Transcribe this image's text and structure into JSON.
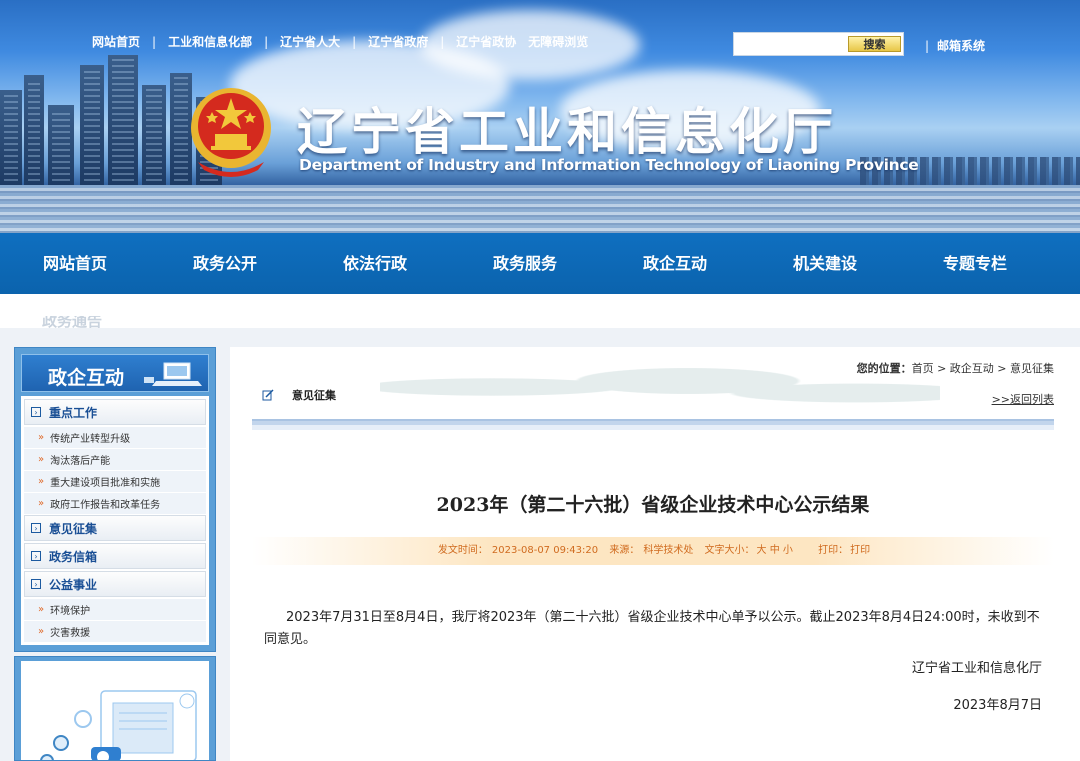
{
  "top_links": [
    "网站首页",
    "工业和信息化部",
    "辽宁省人大",
    "辽宁省政府",
    "辽宁省政协",
    "无障碍浏览"
  ],
  "search": {
    "placeholder": "",
    "button": "搜索"
  },
  "mail_link": "邮箱系统",
  "site": {
    "title": "辽宁省工业和信息化厅",
    "subtitle": "Department of Industry and Information Technology of Liaoning Province"
  },
  "main_nav": [
    "网站首页",
    "政务公开",
    "依法行政",
    "政务服务",
    "政企互动",
    "机关建设",
    "专题专栏"
  ],
  "strip_text": "政务通告",
  "sidebar": {
    "title": "政企互动",
    "groups": [
      {
        "label": "重点工作",
        "items": [
          "传统产业转型升级",
          "淘汰落后产能",
          "重大建设项目批准和实施",
          "政府工作报告和改革任务"
        ]
      },
      {
        "label": "意见征集",
        "items": []
      },
      {
        "label": "政务信箱",
        "items": []
      },
      {
        "label": "公益事业",
        "items": [
          "环境保护",
          "灾害救援"
        ]
      }
    ]
  },
  "breadcrumb": {
    "label": "您的位置：",
    "path": "首页 > 政企互动 > 意见征集"
  },
  "section_title": "意见征集",
  "back_link": ">>返回列表",
  "article": {
    "title": "2023年（第二十六批）省级企业技术中心公示结果",
    "meta": {
      "time_label": "发文时间：",
      "time": "2023-08-07 09:43:20",
      "source_label": "来源：",
      "source": "科学技术处",
      "font_label": "文字大小：",
      "font_sizes": [
        "大",
        "中",
        "小"
      ],
      "print_label": "打印：",
      "print": "打印"
    },
    "body": "2023年7月31日至8月4日，我厅将2023年（第二十六批）省级企业技术中心单予以公示。截止2023年8月4日24:00时，未收到不同意见。",
    "signature": "辽宁省工业和信息化厅",
    "date": "2023年8月7日"
  },
  "colors": {
    "nav_blue": "#0f6fc0",
    "sidebar_blue": "#5b9fd7",
    "meta_orange": "#d06b1f",
    "emblem_red": "#d42a1e",
    "emblem_gold": "#f2c83b"
  }
}
